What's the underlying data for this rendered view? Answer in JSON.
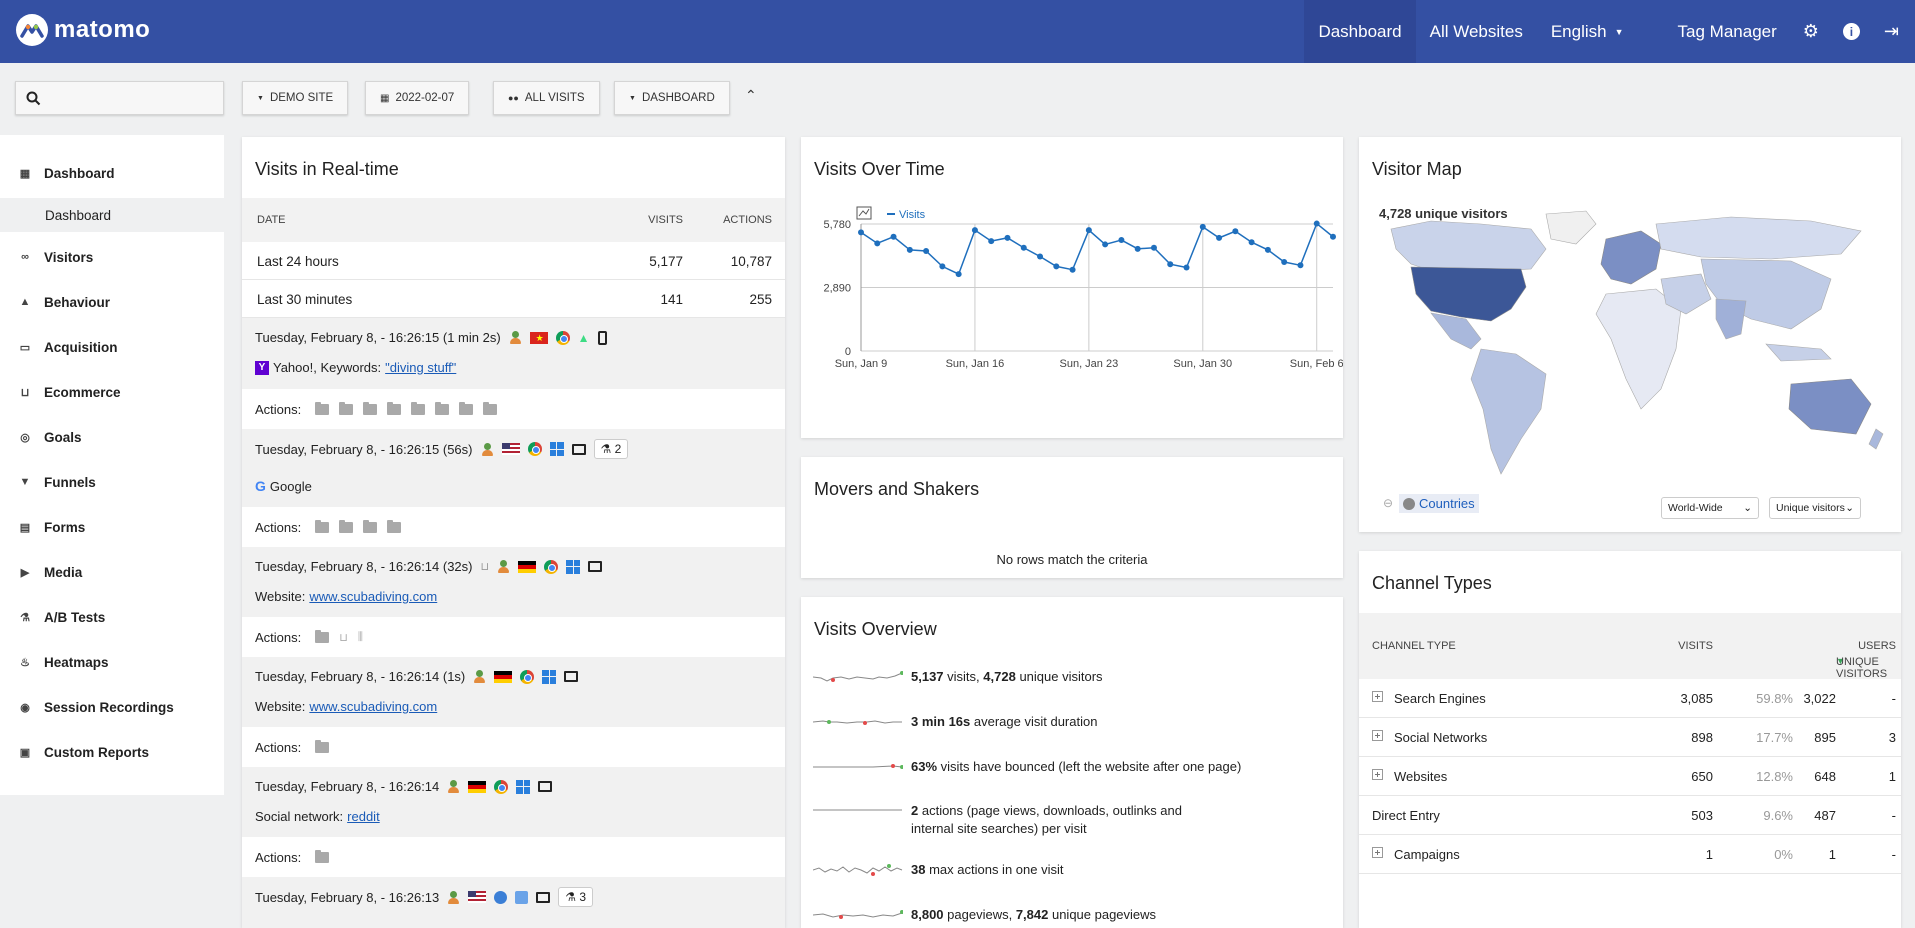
{
  "brand": {
    "name": "matomo"
  },
  "topnav": {
    "dashboard": "Dashboard",
    "all_websites": "All Websites",
    "language": "English",
    "tag_manager": "Tag Manager"
  },
  "filters": {
    "site": "DEMO SITE",
    "date": "2022-02-07",
    "segment": "ALL VISITS",
    "dashboard": "DASHBOARD"
  },
  "sidebar": {
    "dashboard": "Dashboard",
    "dashboard_sub": "Dashboard",
    "items": [
      "Visitors",
      "Behaviour",
      "Acquisition",
      "Ecommerce",
      "Goals",
      "Funnels",
      "Forms",
      "Media",
      "A/B Tests",
      "Heatmaps",
      "Session Recordings",
      "Custom Reports"
    ]
  },
  "realtime": {
    "title": "Visits in Real-time",
    "col_date": "DATE",
    "col_visits": "VISITS",
    "col_actions": "ACTIONS",
    "rows": [
      {
        "label": "Last 24 hours",
        "visits": "5,177",
        "actions": "10,787"
      },
      {
        "label": "Last 30 minutes",
        "visits": "141",
        "actions": "255"
      }
    ],
    "visits": [
      {
        "time": "Tuesday, February 8, - 16:26:15 (1 min 2s)",
        "ref_prefix": "Yahoo!, Keywords:",
        "ref_link": "\"diving stuff\"",
        "actions_label": "Actions:"
      },
      {
        "time": "Tuesday, February 8, - 16:26:15 (56s)",
        "ref_prefix": "Google",
        "ref_link": "",
        "badge": "2",
        "actions_label": "Actions:"
      },
      {
        "time": "Tuesday, February 8, - 16:26:14 (32s)",
        "ref_prefix": "Website:",
        "ref_link": "www.scubadiving.com",
        "actions_label": "Actions:"
      },
      {
        "time": "Tuesday, February 8, - 16:26:14 (1s)",
        "ref_prefix": "Website:",
        "ref_link": "www.scubadiving.com",
        "actions_label": "Actions:"
      },
      {
        "time": "Tuesday, February 8, - 16:26:14",
        "ref_prefix": "Social network:",
        "ref_link": "reddit",
        "actions_label": "Actions:"
      },
      {
        "time": "Tuesday, February 8, - 16:26:13",
        "badge": "3"
      }
    ]
  },
  "overtime": {
    "title": "Visits Over Time",
    "legend": "Visits",
    "chart_data": {
      "type": "line",
      "x": [
        "Jan 9",
        "Jan 10",
        "Jan 11",
        "Jan 12",
        "Jan 13",
        "Jan 14",
        "Jan 15",
        "Jan 16",
        "Jan 17",
        "Jan 18",
        "Jan 19",
        "Jan 20",
        "Jan 21",
        "Jan 22",
        "Jan 23",
        "Jan 24",
        "Jan 25",
        "Jan 26",
        "Jan 27",
        "Jan 28",
        "Jan 29",
        "Jan 30",
        "Jan 31",
        "Feb 1",
        "Feb 2",
        "Feb 3",
        "Feb 4",
        "Feb 5",
        "Feb 6",
        "Feb 7"
      ],
      "series": [
        {
          "name": "Visits",
          "values": [
            5400,
            4900,
            5200,
            4600,
            4550,
            3850,
            3500,
            5500,
            5000,
            5150,
            4700,
            4300,
            3850,
            3700,
            5500,
            4850,
            5050,
            4650,
            4700,
            3950,
            3800,
            5650,
            5150,
            5450,
            4950,
            4600,
            4050,
            3900,
            5800,
            5200
          ]
        }
      ],
      "yticks": [
        "5,780",
        "2,890",
        "0"
      ],
      "ylim": [
        0,
        5780
      ],
      "xticks": [
        "Sun, Jan 9",
        "Sun, Jan 16",
        "Sun, Jan 23",
        "Sun, Jan 30",
        "Sun, Feb 6"
      ]
    }
  },
  "movers": {
    "title": "Movers and Shakers",
    "empty": "No rows match the criteria"
  },
  "overview": {
    "title": "Visits Overview",
    "rows": [
      {
        "b1": "5,137",
        "t1": " visits, ",
        "b2": "4,728",
        "t2": " unique visitors"
      },
      {
        "b1": "3 min 16s",
        "t1": " average visit duration",
        "b2": "",
        "t2": ""
      },
      {
        "b1": "63%",
        "t1": " visits have bounced (left the website after one page)",
        "b2": "",
        "t2": ""
      },
      {
        "b1": "2",
        "t1": " actions (page views, downloads, outlinks and internal site searches) per visit",
        "b2": "",
        "t2": ""
      },
      {
        "b1": "38",
        "t1": " max actions in one visit",
        "b2": "",
        "t2": ""
      },
      {
        "b1": "8,800",
        "t1": " pageviews, ",
        "b2": "7,842",
        "t2": " unique pageviews"
      }
    ]
  },
  "map": {
    "title": "Visitor Map",
    "unique": "4,728 unique visitors",
    "countries": "Countries",
    "region": "World-Wide",
    "metric": "Unique visitors"
  },
  "channels": {
    "title": "Channel Types",
    "col_type": "CHANNEL TYPE",
    "col_visits": "VISITS",
    "col_unique": "UNIQUE VISITORS",
    "col_users": "USERS",
    "rows": [
      {
        "name": "Search Engines",
        "visits": "3,085",
        "pct": "59.8%",
        "unique": "3,022",
        "users": "-"
      },
      {
        "name": "Social Networks",
        "visits": "898",
        "pct": "17.7%",
        "unique": "895",
        "users": "3"
      },
      {
        "name": "Websites",
        "visits": "650",
        "pct": "12.8%",
        "unique": "648",
        "users": "1"
      },
      {
        "name": "Direct Entry",
        "visits": "503",
        "pct": "9.6%",
        "unique": "487",
        "users": "-"
      },
      {
        "name": "Campaigns",
        "visits": "1",
        "pct": "0%",
        "unique": "1",
        "users": "-"
      }
    ]
  }
}
